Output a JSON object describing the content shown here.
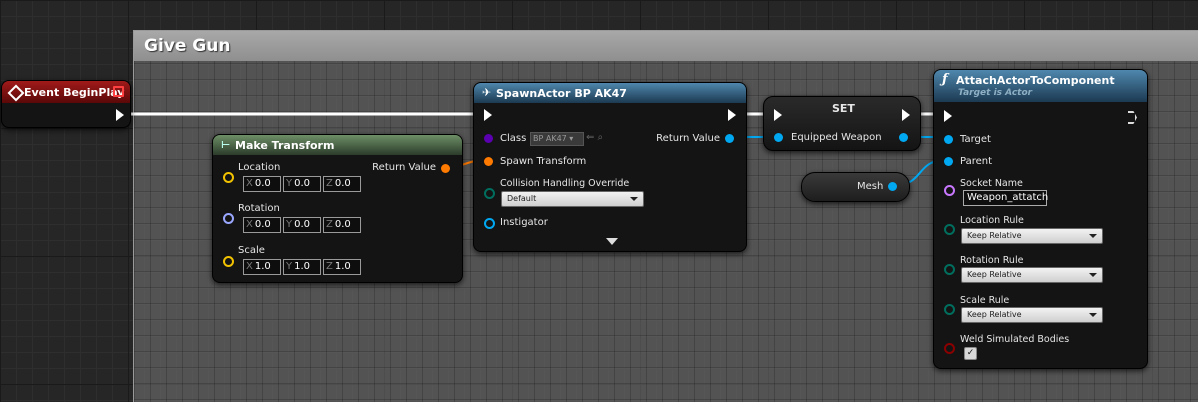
{
  "comment": {
    "title": "Give Gun"
  },
  "event_node": {
    "title": "Event BeginPlay"
  },
  "make_transform": {
    "title": "Make Transform",
    "return_label": "Return Value",
    "location": {
      "label": "Location",
      "x": "0.0",
      "y": "0.0",
      "z": "0.0"
    },
    "rotation": {
      "label": "Rotation",
      "x": "0.0",
      "y": "0.0",
      "z": "0.0"
    },
    "scale": {
      "label": "Scale",
      "x": "1.0",
      "y": "1.0",
      "z": "1.0"
    },
    "axis_x": "X",
    "axis_y": "Y",
    "axis_z": "Z"
  },
  "spawn_actor": {
    "title": "SpawnActor BP AK47",
    "class_label": "Class",
    "class_value": "BP AK47",
    "return_label": "Return Value",
    "spawn_transform_label": "Spawn Transform",
    "collision_label": "Collision Handling Override",
    "collision_value": "Default",
    "instigator_label": "Instigator"
  },
  "set_node": {
    "title": "SET",
    "var_label": "Equipped Weapon"
  },
  "mesh_node": {
    "label": "Mesh"
  },
  "attach_node": {
    "title": "AttachActorToComponent",
    "subtitle": "Target is Actor",
    "target_label": "Target",
    "parent_label": "Parent",
    "socket_label": "Socket Name",
    "socket_value": "Weapon_attatch",
    "location_rule_label": "Location Rule",
    "location_rule_value": "Keep Relative",
    "rotation_rule_label": "Rotation Rule",
    "rotation_rule_value": "Keep Relative",
    "scale_rule_label": "Scale Rule",
    "scale_rule_value": "Keep Relative",
    "weld_label": "Weld Simulated Bodies",
    "weld_checked": "✓"
  },
  "colors": {
    "exec": "#ffffff",
    "object": "#00a8f2",
    "struct_transform": "#ff7a00",
    "vector": "#f2c200",
    "rotator": "#9aa7ff",
    "class": "#5a00b0",
    "byte": "#006e5e",
    "name": "#c878ff",
    "bool": "#8a0000",
    "event_header": "#7a1010",
    "function_header": "#3d6a89",
    "pure_header": "#5b7a55"
  }
}
